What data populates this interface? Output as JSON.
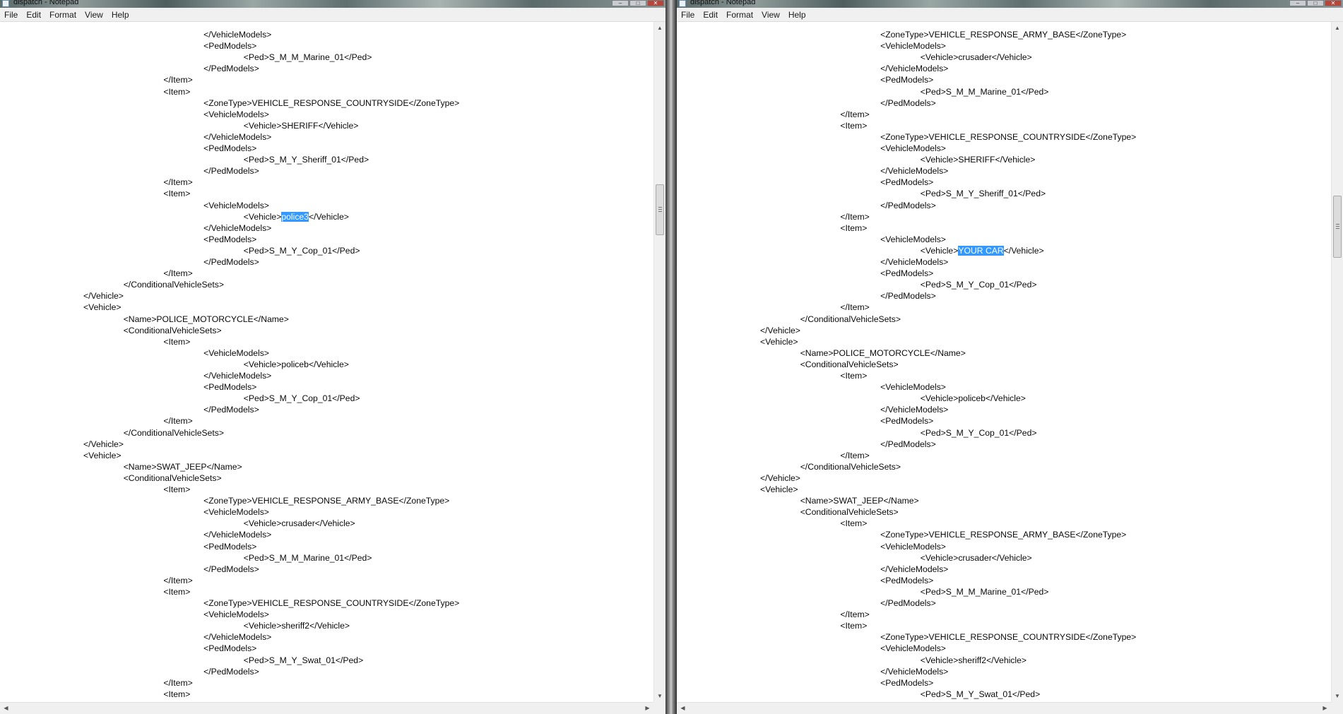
{
  "left_window": {
    "title": "dispatch - Notepad",
    "menu": [
      "File",
      "Edit",
      "Format",
      "View",
      "Help"
    ],
    "controls": [
      "–",
      "□",
      "✕"
    ],
    "lines": [
      {
        "i": 5,
        "pre": "</VehicleModels>"
      },
      {
        "i": 5,
        "pre": "<PedModels>"
      },
      {
        "i": 6,
        "pre": "<Ped>S_M_M_Marine_01</Ped>"
      },
      {
        "i": 5,
        "pre": "</PedModels>"
      },
      {
        "i": 4,
        "pre": "</Item>"
      },
      {
        "i": 4,
        "pre": "<Item>"
      },
      {
        "i": 5,
        "pre": "<ZoneType>VEHICLE_RESPONSE_COUNTRYSIDE</ZoneType>"
      },
      {
        "i": 5,
        "pre": "<VehicleModels>"
      },
      {
        "i": 6,
        "pre": "<Vehicle>SHERIFF</Vehicle>"
      },
      {
        "i": 5,
        "pre": "</VehicleModels>"
      },
      {
        "i": 5,
        "pre": "<PedModels>"
      },
      {
        "i": 6,
        "pre": "<Ped>S_M_Y_Sheriff_01</Ped>"
      },
      {
        "i": 5,
        "pre": "</PedModels>"
      },
      {
        "i": 4,
        "pre": "</Item>"
      },
      {
        "i": 4,
        "pre": "<Item>"
      },
      {
        "i": 5,
        "pre": "<VehicleModels>"
      },
      {
        "i": 6,
        "pre": "<Vehicle>",
        "sel": "police3",
        "post": "</Vehicle>"
      },
      {
        "i": 5,
        "pre": "</VehicleModels>"
      },
      {
        "i": 5,
        "pre": "<PedModels>"
      },
      {
        "i": 6,
        "pre": "<Ped>S_M_Y_Cop_01</Ped>"
      },
      {
        "i": 5,
        "pre": "</PedModels>"
      },
      {
        "i": 4,
        "pre": "</Item>"
      },
      {
        "i": 3,
        "pre": "</ConditionalVehicleSets>"
      },
      {
        "i": 2,
        "pre": "</Vehicle>"
      },
      {
        "i": 2,
        "pre": "<Vehicle>"
      },
      {
        "i": 3,
        "pre": "<Name>POLICE_MOTORCYCLE</Name>"
      },
      {
        "i": 3,
        "pre": "<ConditionalVehicleSets>"
      },
      {
        "i": 4,
        "pre": "<Item>"
      },
      {
        "i": 5,
        "pre": "<VehicleModels>"
      },
      {
        "i": 6,
        "pre": "<Vehicle>policeb</Vehicle>"
      },
      {
        "i": 5,
        "pre": "</VehicleModels>"
      },
      {
        "i": 5,
        "pre": "<PedModels>"
      },
      {
        "i": 6,
        "pre": "<Ped>S_M_Y_Cop_01</Ped>"
      },
      {
        "i": 5,
        "pre": "</PedModels>"
      },
      {
        "i": 4,
        "pre": "</Item>"
      },
      {
        "i": 3,
        "pre": "</ConditionalVehicleSets>"
      },
      {
        "i": 2,
        "pre": "</Vehicle>"
      },
      {
        "i": 2,
        "pre": "<Vehicle>"
      },
      {
        "i": 3,
        "pre": "<Name>SWAT_JEEP</Name>"
      },
      {
        "i": 3,
        "pre": "<ConditionalVehicleSets>"
      },
      {
        "i": 4,
        "pre": "<Item>"
      },
      {
        "i": 5,
        "pre": "<ZoneType>VEHICLE_RESPONSE_ARMY_BASE</ZoneType>"
      },
      {
        "i": 5,
        "pre": "<VehicleModels>"
      },
      {
        "i": 6,
        "pre": "<Vehicle>crusader</Vehicle>"
      },
      {
        "i": 5,
        "pre": "</VehicleModels>"
      },
      {
        "i": 5,
        "pre": "<PedModels>"
      },
      {
        "i": 6,
        "pre": "<Ped>S_M_M_Marine_01</Ped>"
      },
      {
        "i": 5,
        "pre": "</PedModels>"
      },
      {
        "i": 4,
        "pre": "</Item>"
      },
      {
        "i": 4,
        "pre": "<Item>"
      },
      {
        "i": 5,
        "pre": "<ZoneType>VEHICLE_RESPONSE_COUNTRYSIDE</ZoneType>"
      },
      {
        "i": 5,
        "pre": "<VehicleModels>"
      },
      {
        "i": 6,
        "pre": "<Vehicle>sheriff2</Vehicle>"
      },
      {
        "i": 5,
        "pre": "</VehicleModels>"
      },
      {
        "i": 5,
        "pre": "<PedModels>"
      },
      {
        "i": 6,
        "pre": "<Ped>S_M_Y_Swat_01</Ped>"
      },
      {
        "i": 5,
        "pre": "</PedModels>"
      },
      {
        "i": 4,
        "pre": "</Item>"
      },
      {
        "i": 4,
        "pre": "<Item>"
      }
    ]
  },
  "right_window": {
    "title": "dispatch - Notepad",
    "menu": [
      "File",
      "Edit",
      "Format",
      "View",
      "Help"
    ],
    "controls": [
      "–",
      "□",
      "✕"
    ],
    "lines": [
      {
        "i": 5,
        "pre": "<ZoneType>VEHICLE_RESPONSE_ARMY_BASE</ZoneType>"
      },
      {
        "i": 5,
        "pre": "<VehicleModels>"
      },
      {
        "i": 6,
        "pre": "<Vehicle>crusader</Vehicle>"
      },
      {
        "i": 5,
        "pre": "</VehicleModels>"
      },
      {
        "i": 5,
        "pre": "<PedModels>"
      },
      {
        "i": 6,
        "pre": "<Ped>S_M_M_Marine_01</Ped>"
      },
      {
        "i": 5,
        "pre": "</PedModels>"
      },
      {
        "i": 4,
        "pre": "</Item>"
      },
      {
        "i": 4,
        "pre": "<Item>"
      },
      {
        "i": 5,
        "pre": "<ZoneType>VEHICLE_RESPONSE_COUNTRYSIDE</ZoneType>"
      },
      {
        "i": 5,
        "pre": "<VehicleModels>"
      },
      {
        "i": 6,
        "pre": "<Vehicle>SHERIFF</Vehicle>"
      },
      {
        "i": 5,
        "pre": "</VehicleModels>"
      },
      {
        "i": 5,
        "pre": "<PedModels>"
      },
      {
        "i": 6,
        "pre": "<Ped>S_M_Y_Sheriff_01</Ped>"
      },
      {
        "i": 5,
        "pre": "</PedModels>"
      },
      {
        "i": 4,
        "pre": "</Item>"
      },
      {
        "i": 4,
        "pre": "<Item>"
      },
      {
        "i": 5,
        "pre": "<VehicleModels>"
      },
      {
        "i": 6,
        "pre": "<Vehicle>",
        "sel": "YOUR CAR",
        "post": "</Vehicle>"
      },
      {
        "i": 5,
        "pre": "</VehicleModels>"
      },
      {
        "i": 5,
        "pre": "<PedModels>"
      },
      {
        "i": 6,
        "pre": "<Ped>S_M_Y_Cop_01</Ped>"
      },
      {
        "i": 5,
        "pre": "</PedModels>"
      },
      {
        "i": 4,
        "pre": "</Item>"
      },
      {
        "i": 3,
        "pre": "</ConditionalVehicleSets>"
      },
      {
        "i": 2,
        "pre": "</Vehicle>"
      },
      {
        "i": 2,
        "pre": "<Vehicle>"
      },
      {
        "i": 3,
        "pre": "<Name>POLICE_MOTORCYCLE</Name>"
      },
      {
        "i": 3,
        "pre": "<ConditionalVehicleSets>"
      },
      {
        "i": 4,
        "pre": "<Item>"
      },
      {
        "i": 5,
        "pre": "<VehicleModels>"
      },
      {
        "i": 6,
        "pre": "<Vehicle>policeb</Vehicle>"
      },
      {
        "i": 5,
        "pre": "</VehicleModels>"
      },
      {
        "i": 5,
        "pre": "<PedModels>"
      },
      {
        "i": 6,
        "pre": "<Ped>S_M_Y_Cop_01</Ped>"
      },
      {
        "i": 5,
        "pre": "</PedModels>"
      },
      {
        "i": 4,
        "pre": "</Item>"
      },
      {
        "i": 3,
        "pre": "</ConditionalVehicleSets>"
      },
      {
        "i": 2,
        "pre": "</Vehicle>"
      },
      {
        "i": 2,
        "pre": "<Vehicle>"
      },
      {
        "i": 3,
        "pre": "<Name>SWAT_JEEP</Name>"
      },
      {
        "i": 3,
        "pre": "<ConditionalVehicleSets>"
      },
      {
        "i": 4,
        "pre": "<Item>"
      },
      {
        "i": 5,
        "pre": "<ZoneType>VEHICLE_RESPONSE_ARMY_BASE</ZoneType>"
      },
      {
        "i": 5,
        "pre": "<VehicleModels>"
      },
      {
        "i": 6,
        "pre": "<Vehicle>crusader</Vehicle>"
      },
      {
        "i": 5,
        "pre": "</VehicleModels>"
      },
      {
        "i": 5,
        "pre": "<PedModels>"
      },
      {
        "i": 6,
        "pre": "<Ped>S_M_M_Marine_01</Ped>"
      },
      {
        "i": 5,
        "pre": "</PedModels>"
      },
      {
        "i": 4,
        "pre": "</Item>"
      },
      {
        "i": 4,
        "pre": "<Item>"
      },
      {
        "i": 5,
        "pre": "<ZoneType>VEHICLE_RESPONSE_COUNTRYSIDE</ZoneType>"
      },
      {
        "i": 5,
        "pre": "<VehicleModels>"
      },
      {
        "i": 6,
        "pre": "<Vehicle>sheriff2</Vehicle>"
      },
      {
        "i": 5,
        "pre": "</VehicleModels>"
      },
      {
        "i": 5,
        "pre": "<PedModels>"
      },
      {
        "i": 6,
        "pre": "<Ped>S_M_Y_Swat_01</Ped>"
      }
    ]
  },
  "icons": {
    "app": "notepad-icon",
    "scroll_up": "up-arrow-icon",
    "scroll_down": "down-arrow-icon",
    "scroll_left": "left-arrow-icon",
    "scroll_right": "right-arrow-icon"
  },
  "colors": {
    "selection": "#3399ff",
    "menubar": "#f0f0f0",
    "text": "#0a0a0a"
  }
}
